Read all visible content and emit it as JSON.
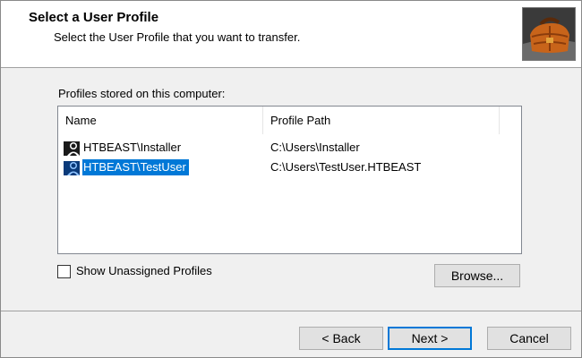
{
  "header": {
    "title": "Select a User Profile",
    "subtitle": "Select the User Profile that you want to transfer."
  },
  "profiles_group": {
    "label": "Profiles stored on this computer:"
  },
  "listview": {
    "columns": [
      "Name",
      "Profile Path"
    ],
    "rows": [
      {
        "name": "HTBEAST\\Installer",
        "path": "C:\\Users\\Installer",
        "selected": false
      },
      {
        "name": "HTBEAST\\TestUser",
        "path": "C:\\Users\\TestUser.HTBEAST",
        "selected": true
      }
    ]
  },
  "show_unassigned": {
    "label": "Show Unassigned Profiles",
    "checked": false
  },
  "buttons": {
    "browse": "Browse...",
    "back": "< Back",
    "next": "Next >",
    "cancel": "Cancel"
  },
  "colors": {
    "selection": "#0078d7",
    "default_button_border": "#0078d7"
  },
  "icons": {
    "profile": "user-profile-icon",
    "header_image": "suitcase-icon"
  }
}
